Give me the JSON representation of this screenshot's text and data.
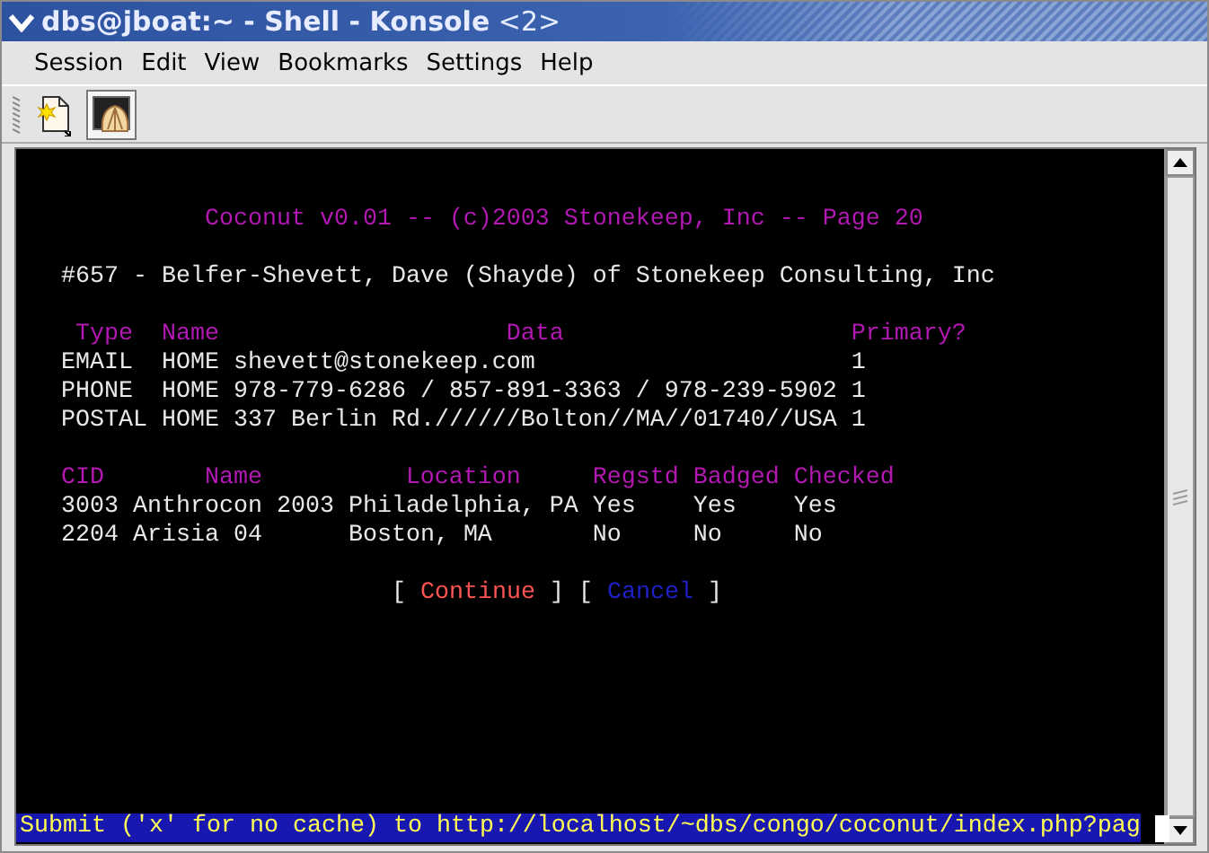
{
  "window": {
    "title": "**dbs@jboat:~ - Shell - Konsole** <2>"
  },
  "menu": [
    "Session",
    "Edit",
    "View",
    "Bookmarks",
    "Settings",
    "Help"
  ],
  "toolbar": [
    {
      "kind": "new-session",
      "pressed": false
    },
    {
      "kind": "shell",
      "pressed": true
    }
  ],
  "terminal": {
    "heading": "Coconut v0.01 -- (c)2003 Stonekeep, Inc -- Page 20",
    "record": "#657 - Belfer-Shevett, Dave (Shayde) of Stonekeep Consulting, Inc",
    "contacts": {
      "columns": [
        "Type",
        "Name",
        "Data",
        "Primary?"
      ],
      "rows": [
        [
          "EMAIL",
          "HOME",
          "shevett@stonekeep.com",
          "1"
        ],
        [
          "PHONE",
          "HOME",
          "978-779-6286 / 857-891-3363 / 978-239-5902",
          "1"
        ],
        [
          "POSTAL",
          "HOME",
          "337 Berlin Rd.//////Bolton//MA//01740//USA",
          "1"
        ]
      ]
    },
    "events": {
      "columns": [
        "CID",
        "Name",
        "Location",
        "Regstd",
        "Badged",
        "Checked"
      ],
      "rows": [
        [
          "3003",
          "Anthrocon 2003",
          "Philadelphia, PA",
          "Yes",
          "Yes",
          "Yes"
        ],
        [
          "2204",
          "Arisia 04",
          "Boston, MA",
          "No",
          "No",
          "No"
        ]
      ]
    },
    "actions": [
      {
        "kind": "bracket",
        "text": "["
      },
      {
        "kind": "continue",
        "text": "Continue"
      },
      {
        "kind": "bracket",
        "text": "]"
      },
      {
        "kind": "bracket",
        "text": "["
      },
      {
        "kind": "cancel",
        "text": "Cancel"
      },
      {
        "kind": "bracket",
        "text": "]"
      }
    ],
    "status_line": "Submit ('x' for no cache) to http://localhost/~dbs/congo/coconut/index.php?pag"
  }
}
